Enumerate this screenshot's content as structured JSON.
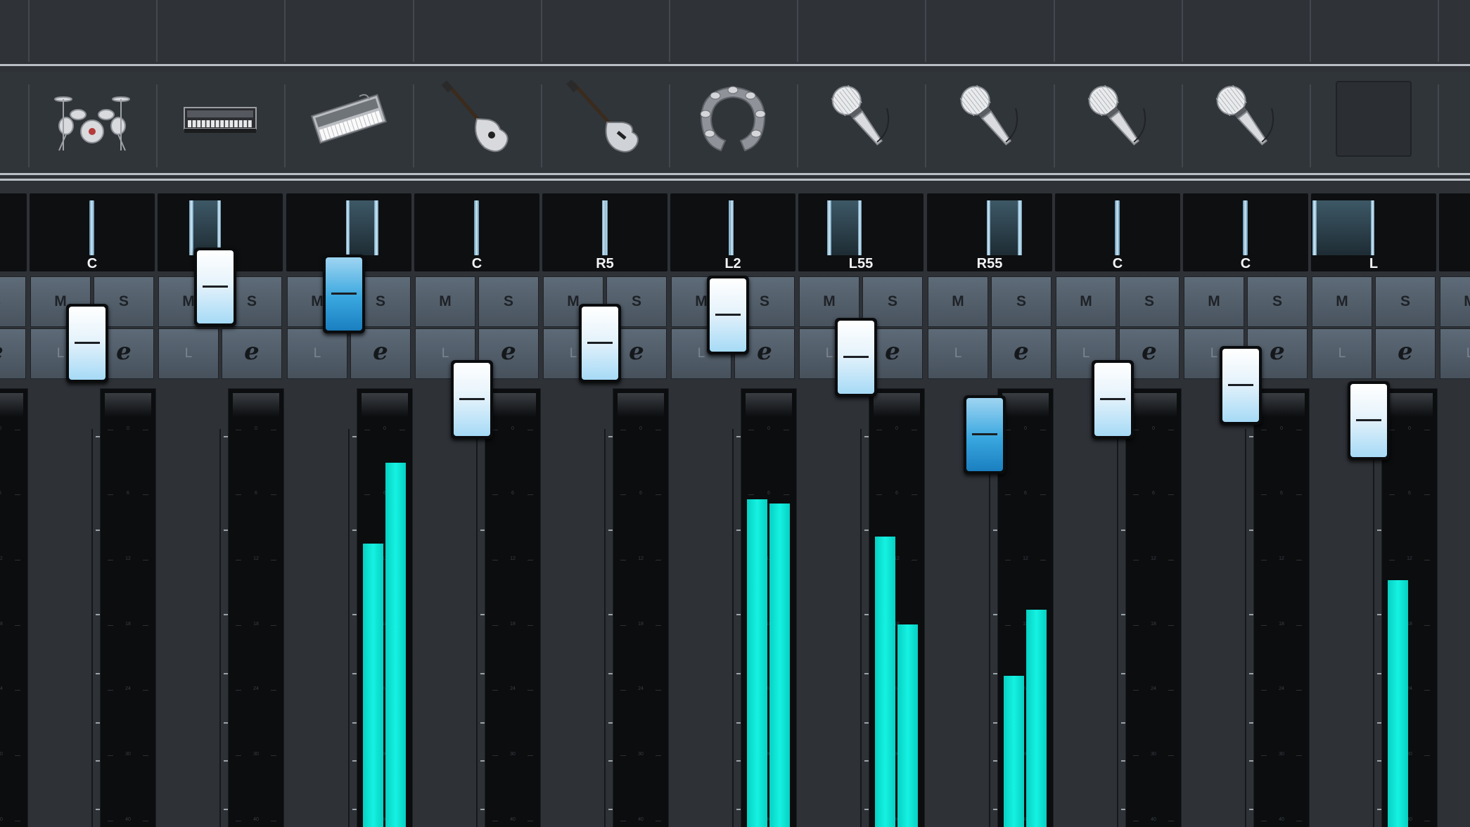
{
  "mixer": {
    "colors": {
      "background": "#2e3237",
      "meter_level": "#11e8d8",
      "fader_cap": "#e6f3fb",
      "fader_cap_active": "#39a7df",
      "button_fill": "#566370"
    },
    "scale_labels": [
      "6",
      "0",
      "5",
      "10",
      "15",
      "20",
      "30"
    ],
    "meter_tick_labels": [
      "0",
      "6",
      "12",
      "18",
      "24",
      "30",
      "40"
    ],
    "mute_label": "M",
    "solo_label": "S",
    "lock_label": "L",
    "edit_label": "e",
    "channels": [
      {
        "id": "0",
        "icon": "partial-channel-icon",
        "pan": "",
        "pan_value": 0,
        "fader_level": 0.62,
        "fader_active": false,
        "meter": [
          0.5,
          0.0
        ]
      },
      {
        "id": "1",
        "icon": "drum-kit-icon",
        "pan": "C",
        "pan_value": 0,
        "fader_level": 0.62,
        "fader_active": false,
        "meter": [
          0.0,
          0.0
        ]
      },
      {
        "id": "2",
        "icon": "synthesizer-icon",
        "pan": "L50",
        "pan_value": -50,
        "fader_level": 0.7,
        "fader_active": false,
        "meter": [
          0.0,
          0.0
        ]
      },
      {
        "id": "3",
        "icon": "keyboard-icon",
        "pan": "R50",
        "pan_value": 50,
        "fader_level": 0.69,
        "fader_active": true,
        "meter": [
          0.4,
          0.51
        ]
      },
      {
        "id": "4",
        "icon": "electric-guitar-icon",
        "pan": "C",
        "pan_value": 0,
        "fader_level": 0.54,
        "fader_active": false,
        "meter": [
          0.0,
          0.0
        ]
      },
      {
        "id": "5",
        "icon": "bass-guitar-icon",
        "pan": "R5",
        "pan_value": 5,
        "fader_level": 0.62,
        "fader_active": false,
        "meter": [
          0.0,
          0.0
        ]
      },
      {
        "id": "6",
        "icon": "tambourine-icon",
        "pan": "L2",
        "pan_value": -2,
        "fader_level": 0.66,
        "fader_active": false,
        "meter": [
          0.46,
          0.455
        ]
      },
      {
        "id": "7",
        "icon": "microphone-icon",
        "pan": "L55",
        "pan_value": -55,
        "fader_level": 0.6,
        "fader_active": false,
        "meter": [
          0.41,
          0.29
        ]
      },
      {
        "id": "8",
        "icon": "microphone-icon",
        "pan": "R55",
        "pan_value": 55,
        "fader_level": 0.49,
        "fader_active": true,
        "meter": [
          0.22,
          0.31
        ]
      },
      {
        "id": "9",
        "icon": "microphone-icon",
        "pan": "C",
        "pan_value": 0,
        "fader_level": 0.54,
        "fader_active": false,
        "meter": [
          0.0,
          0.0
        ]
      },
      {
        "id": "10",
        "icon": "microphone-icon",
        "pan": "C",
        "pan_value": 0,
        "fader_level": 0.56,
        "fader_active": false,
        "meter": [
          0.0,
          0.0
        ]
      },
      {
        "id": "11",
        "icon": "empty-slot-icon",
        "pan": "L",
        "pan_value": -100,
        "fader_level": 0.51,
        "fader_active": false,
        "meter": [
          0.35,
          0.0
        ]
      },
      {
        "id": "12",
        "icon": "partial-channel-icon",
        "pan": "",
        "pan_value": 0,
        "fader_level": 0.74,
        "fader_active": false,
        "meter": [
          0.0,
          0.0
        ]
      }
    ]
  }
}
